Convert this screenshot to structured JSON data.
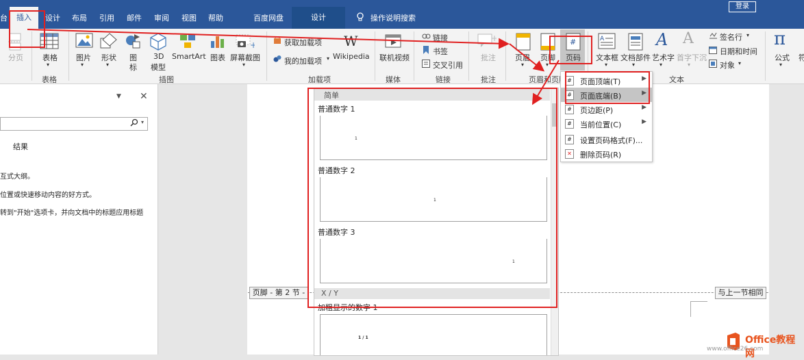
{
  "tabs": {
    "partial_left": "台",
    "insert": "插入",
    "design": "设计",
    "layout": "布局",
    "references": "引用",
    "mailings": "邮件",
    "review": "审阅",
    "view": "视图",
    "help": "帮助",
    "baidu": "百度网盘",
    "context_design": "设计",
    "tell_me": "操作说明搜索",
    "signin": "登录"
  },
  "ribbon": {
    "page_break": "分页",
    "table": "表格",
    "table_group": "表格",
    "pictures": "图片",
    "shapes": "形状",
    "icons_a": "图",
    "icons_b": "标",
    "model_a": "3D",
    "model_b": "模型",
    "smartart": "SmartArt",
    "chart": "图表",
    "screenshot": "屏幕截图",
    "illustrations_group": "插图",
    "get_addins": "获取加载项",
    "my_addins": "我的加载项",
    "wikipedia": "Wikipedia",
    "addins_group": "加载项",
    "online_video": "联机视频",
    "media_group": "媒体",
    "link": "链接",
    "bookmark": "书签",
    "cross_ref": "交叉引用",
    "links_group": "链接",
    "comment": "批注",
    "comments_group": "批注",
    "header": "页眉",
    "footer": "页脚",
    "page_number": "页码",
    "hf_group": "页眉和页脚",
    "textbox": "文本框",
    "quickparts": "文档部件",
    "wordart": "艺术字",
    "dropcap": "首字下沉",
    "signature": "签名行",
    "datetime": "日期和时间",
    "object": "对象",
    "text_group": "文本",
    "equation": "公式",
    "symbol_partial": "符"
  },
  "nav": {
    "results": "结果",
    "line1": "互式大纲。",
    "line2": "位置或快速移动内容的好方式。",
    "line3": "转到\"开始\"选项卡，并向文档中的标题应用标题"
  },
  "gallery": {
    "section_simple": "简单",
    "item1": "普通数字 1",
    "item2": "普通数字 2",
    "item3": "普通数字 3",
    "section_xy": "X / Y",
    "item4": "加粗显示的数字 1",
    "digit": "1",
    "xy_sample": "1 / 1"
  },
  "menu": {
    "top": "页面顶端(T)",
    "bottom": "页面底端(B)",
    "margin": "页边距(P)",
    "current": "当前位置(C)",
    "format": "设置页码格式(F)...",
    "remove": "删除页码(R)"
  },
  "doc": {
    "footer_marker": "页脚 - 第 2 节 -",
    "same_as_prev": "与上一节相同"
  },
  "watermark": {
    "brand": "Office教程网",
    "url": "www.office26.com"
  },
  "colors": {
    "ribbon_blue": "#2b579a",
    "annotation_red": "#e02020"
  }
}
